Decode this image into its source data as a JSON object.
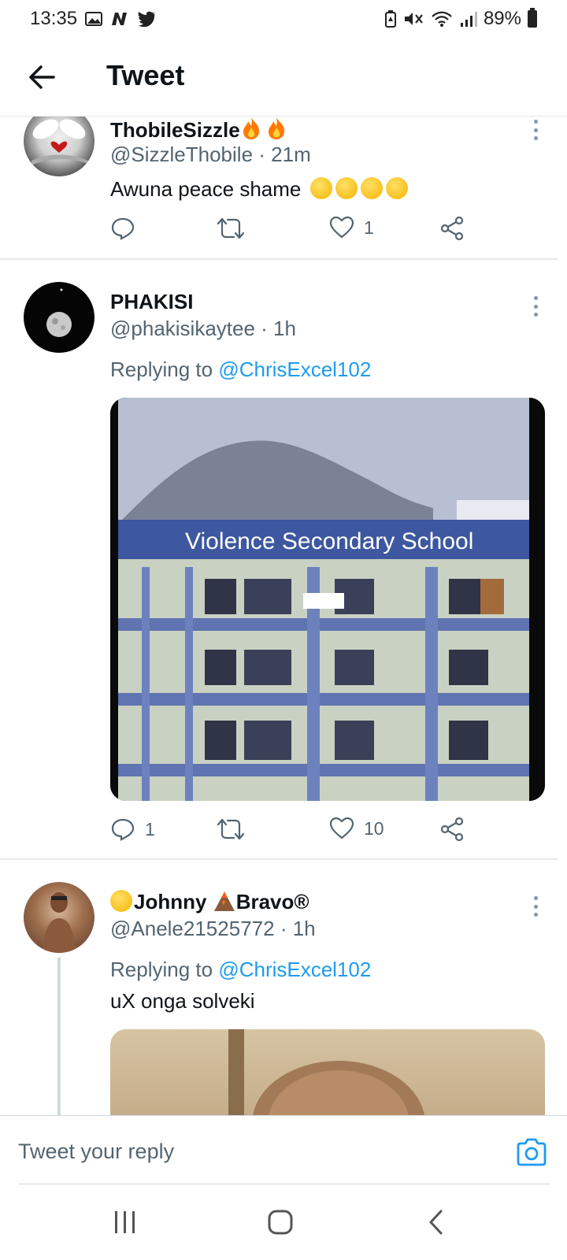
{
  "status_bar": {
    "time": "13:35",
    "battery": "89%",
    "icons": [
      "gallery-icon",
      "news-icon",
      "twitter-bird-icon",
      "battery-saver-icon",
      "mute-icon",
      "wifi-icon",
      "signal-icon",
      "battery-icon"
    ]
  },
  "header": {
    "title": "Tweet",
    "back_icon": "back-arrow-icon"
  },
  "tweets": [
    {
      "name": "ThobileSizzle",
      "name_suffix_icons": [
        "fire-emoji",
        "fire-emoji"
      ],
      "handle": "@SizzleThobile",
      "time": "· 21m",
      "text": "Awuna peace shame",
      "text_emojis": [
        "rofl-emoji",
        "rofl-emoji",
        "rofl-emoji",
        "rofl-emoji"
      ],
      "reply_count": "",
      "retweet_count": "",
      "like_count": "1"
    },
    {
      "name": "PHAKISI",
      "handle": "@phakisikaytee",
      "time": "· 1h",
      "replying_prefix": "Replying to",
      "replying_to": "@ChrisExcel102",
      "media_text": "Violence Secondary School",
      "reply_count": "1",
      "retweet_count": "",
      "like_count": "10"
    },
    {
      "name_prefix_emoji": "sunglasses-emoji",
      "name_part1": "Johnny",
      "name_mid_emoji": "volcano-emoji",
      "name_part2": "Bravo®",
      "handle": "@Anele21525772",
      "time": "· 1h",
      "replying_prefix": "Replying to",
      "replying_to": "@ChrisExcel102",
      "text": "uX onga solveki"
    }
  ],
  "reply_bar": {
    "placeholder": "Tweet your reply",
    "camera_icon": "camera-icon"
  },
  "nav_bar": {
    "icons": [
      "recent-apps-icon",
      "home-icon",
      "back-icon"
    ]
  },
  "colors": {
    "accent": "#1d9bf0",
    "secondary_text": "#536471",
    "divider": "#e6e9ec"
  }
}
